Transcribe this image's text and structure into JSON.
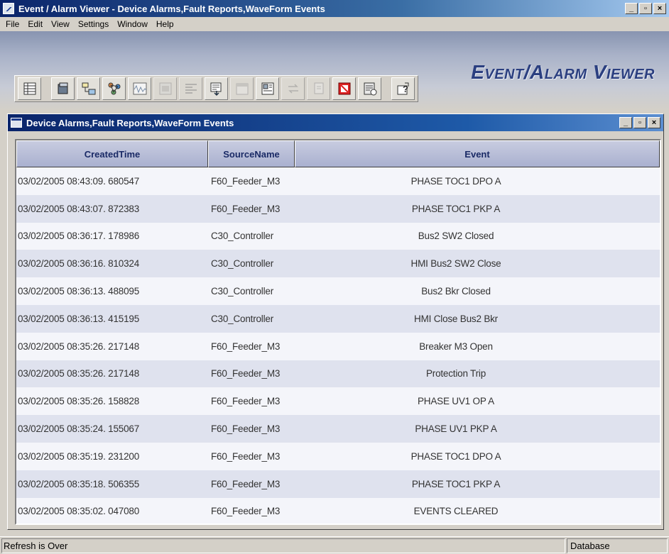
{
  "window": {
    "title": "Event / Alarm Viewer - Device Alarms,Fault Reports,WaveForm Events",
    "minimize": "_",
    "maximize": "▫",
    "close": "×"
  },
  "menu": [
    "File",
    "Edit",
    "View",
    "Settings",
    "Window",
    "Help"
  ],
  "banner": {
    "title": "Event/Alarm Viewer"
  },
  "toolbar": {
    "buttons": [
      {
        "icon": "grid-icon",
        "enabled": true
      },
      {
        "icon": "device-icon",
        "enabled": true
      },
      {
        "icon": "network-icon",
        "enabled": true
      },
      {
        "icon": "nodes-icon",
        "enabled": true
      },
      {
        "icon": "waveform-icon",
        "enabled": true
      },
      {
        "icon": "report-icon",
        "enabled": false
      },
      {
        "icon": "settings-panel-icon",
        "enabled": false
      },
      {
        "icon": "export-icon",
        "enabled": true
      },
      {
        "icon": "calendar-icon",
        "enabled": false
      },
      {
        "icon": "layout-icon",
        "enabled": true
      },
      {
        "icon": "transfer-icon",
        "enabled": false
      },
      {
        "icon": "copy-icon",
        "enabled": false
      },
      {
        "icon": "stop-icon",
        "enabled": true
      },
      {
        "icon": "database-icon",
        "enabled": true
      },
      {
        "icon": "help-icon",
        "enabled": true
      }
    ]
  },
  "child_window": {
    "title": "Device Alarms,Fault Reports,WaveForm Events"
  },
  "table": {
    "columns": [
      "CreatedTime",
      "SourceName",
      "Event"
    ],
    "rows": [
      [
        "03/02/2005 08:43:09. 680547",
        "F60_Feeder_M3",
        "PHASE TOC1 DPO A"
      ],
      [
        "03/02/2005 08:43:07. 872383",
        "F60_Feeder_M3",
        "PHASE TOC1 PKP A"
      ],
      [
        "03/02/2005 08:36:17. 178986",
        "C30_Controller",
        "Bus2 SW2 Closed"
      ],
      [
        "03/02/2005 08:36:16. 810324",
        "C30_Controller",
        "HMI Bus2 SW2 Close"
      ],
      [
        "03/02/2005 08:36:13. 488095",
        "C30_Controller",
        "Bus2 Bkr Closed"
      ],
      [
        "03/02/2005 08:36:13. 415195",
        "C30_Controller",
        "HMI Close Bus2 Bkr"
      ],
      [
        "03/02/2005 08:35:26. 217148",
        "F60_Feeder_M3",
        "Breaker M3 Open"
      ],
      [
        "03/02/2005 08:35:26. 217148",
        "F60_Feeder_M3",
        "Protection Trip"
      ],
      [
        "03/02/2005 08:35:26. 158828",
        "F60_Feeder_M3",
        "PHASE UV1 OP A"
      ],
      [
        "03/02/2005 08:35:24. 155067",
        "F60_Feeder_M3",
        "PHASE UV1 PKP A"
      ],
      [
        "03/02/2005 08:35:19. 231200",
        "F60_Feeder_M3",
        "PHASE TOC1 DPO A"
      ],
      [
        "03/02/2005 08:35:18. 506355",
        "F60_Feeder_M3",
        "PHASE TOC1 PKP A"
      ],
      [
        "03/02/2005 08:35:02. 047080",
        "F60_Feeder_M3",
        "EVENTS CLEARED"
      ]
    ]
  },
  "status": {
    "message": "Refresh is Over",
    "panel": "Database"
  }
}
